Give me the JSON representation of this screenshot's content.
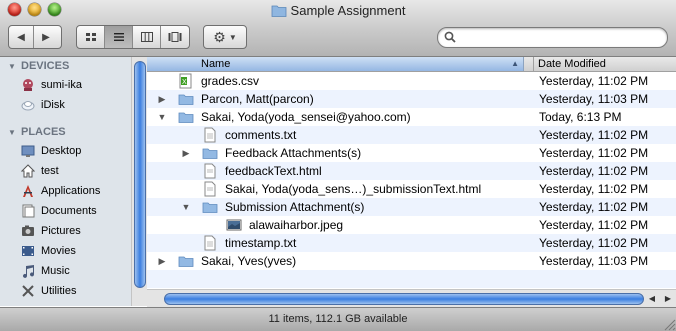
{
  "window": {
    "title": "Sample Assignment"
  },
  "toolbar": {
    "back_icon": "back-arrow-icon",
    "forward_icon": "forward-arrow-icon",
    "views": [
      "icon-view",
      "list-view",
      "column-view",
      "coverflow-view"
    ],
    "active_view": "list-view",
    "action_icon": "gear-icon",
    "search_placeholder": ""
  },
  "sidebar": {
    "sections": [
      {
        "label": "DEVICES",
        "items": [
          {
            "label": "sumi-ika",
            "icon": "computer-icon"
          },
          {
            "label": "iDisk",
            "icon": "idisk-icon"
          }
        ]
      },
      {
        "label": "PLACES",
        "items": [
          {
            "label": "Desktop",
            "icon": "desktop-icon"
          },
          {
            "label": "test",
            "icon": "home-icon"
          },
          {
            "label": "Applications",
            "icon": "applications-icon"
          },
          {
            "label": "Documents",
            "icon": "documents-icon"
          },
          {
            "label": "Pictures",
            "icon": "pictures-icon"
          },
          {
            "label": "Movies",
            "icon": "movies-icon"
          },
          {
            "label": "Music",
            "icon": "music-icon"
          },
          {
            "label": "Utilities",
            "icon": "utilities-icon"
          }
        ]
      }
    ]
  },
  "columns": {
    "name": "Name",
    "date": "Date Modified"
  },
  "files": [
    {
      "name": "grades.csv",
      "date": "Yesterday, 11:02 PM",
      "icon": "csv-file-icon"
    },
    {
      "name": "Parcon, Matt(parcon)",
      "date": "Yesterday, 11:03 PM",
      "icon": "folder-icon"
    },
    {
      "name": "Sakai, Yoda(yoda_sensei@yahoo.com)",
      "date": "Today, 6:13 PM",
      "icon": "folder-icon"
    },
    {
      "name": "comments.txt",
      "date": "Yesterday, 11:02 PM",
      "icon": "text-file-icon"
    },
    {
      "name": "Feedback Attachments(s)",
      "date": "Yesterday, 11:02 PM",
      "icon": "folder-icon"
    },
    {
      "name": "feedbackText.html",
      "date": "Yesterday, 11:02 PM",
      "icon": "html-file-icon"
    },
    {
      "name": "Sakai, Yoda(yoda_sens…)_submissionText.html",
      "date": "Yesterday, 11:02 PM",
      "icon": "html-file-icon"
    },
    {
      "name": "Submission Attachment(s)",
      "date": "Yesterday, 11:02 PM",
      "icon": "folder-icon"
    },
    {
      "name": "alawaiharbor.jpeg",
      "date": "Yesterday, 11:02 PM",
      "icon": "image-file-icon"
    },
    {
      "name": "timestamp.txt",
      "date": "Yesterday, 11:02 PM",
      "icon": "text-file-icon"
    },
    {
      "name": "Sakai, Yves(yves)",
      "date": "Yesterday, 11:03 PM",
      "icon": "folder-icon"
    }
  ],
  "status": {
    "text": "11 items, 112.1 GB available"
  }
}
